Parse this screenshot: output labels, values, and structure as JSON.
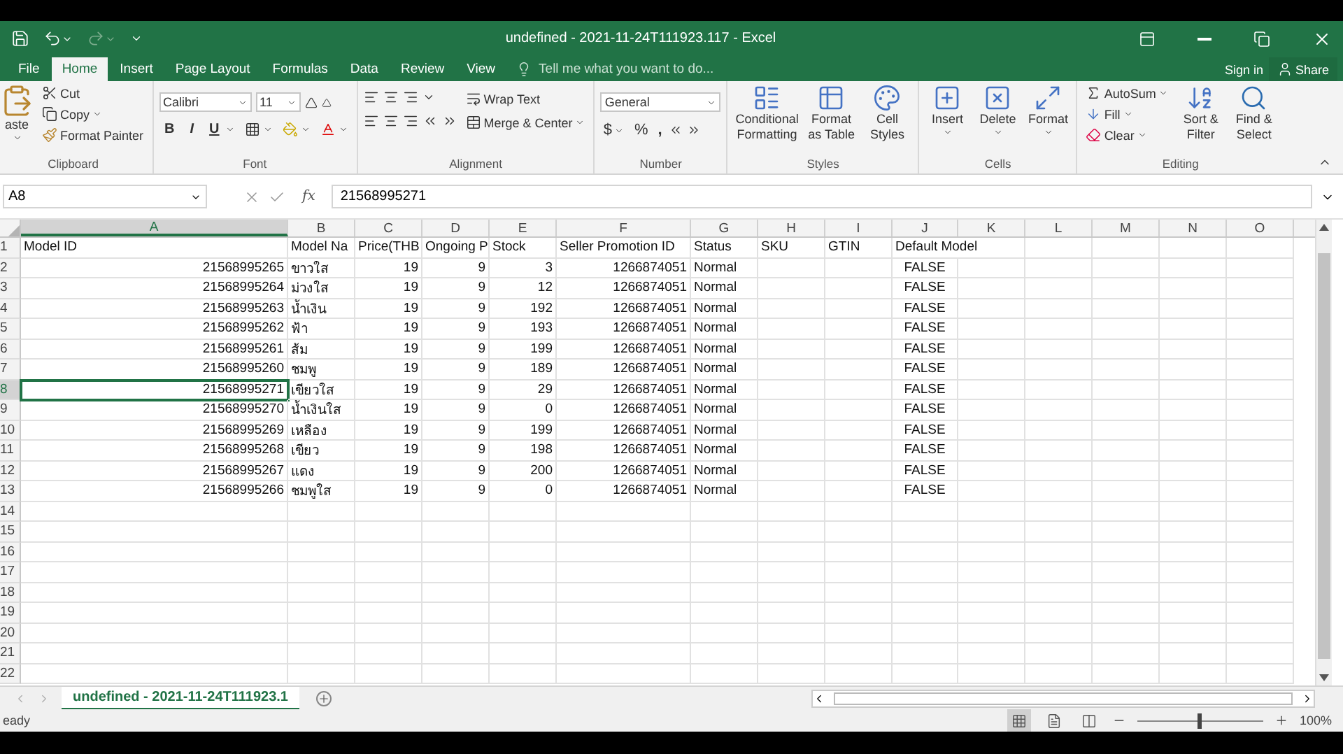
{
  "window": {
    "title": "undefined - 2021-11-24T111923.117 - Excel"
  },
  "menu_tabs": [
    {
      "label": "File",
      "selected": false
    },
    {
      "label": "Home",
      "selected": true
    },
    {
      "label": "Insert",
      "selected": false
    },
    {
      "label": "Page Layout",
      "selected": false
    },
    {
      "label": "Formulas",
      "selected": false
    },
    {
      "label": "Data",
      "selected": false
    },
    {
      "label": "Review",
      "selected": false
    },
    {
      "label": "View",
      "selected": false
    }
  ],
  "tell_me": {
    "placeholder": "Tell me what you want to do..."
  },
  "account": {
    "sign_in": "Sign in",
    "share": "Share"
  },
  "clipboard": {
    "paste": "aste",
    "cut": "Cut",
    "copy": "Copy",
    "format_painter": "Format Painter",
    "label": "Clipboard"
  },
  "font": {
    "name": "Calibri",
    "size": "11",
    "bold": "B",
    "italic": "I",
    "underline": "U",
    "label": "Font"
  },
  "alignment": {
    "wrap_text": "Wrap Text",
    "merge": "Merge & Center",
    "label": "Alignment"
  },
  "number": {
    "format": "General",
    "currency": "$",
    "percent": "%",
    "comma": ",",
    "label": "Number"
  },
  "styles": {
    "buttons": [
      "Conditional Formatting",
      "Format as Table",
      "Cell Styles"
    ],
    "label": "Styles"
  },
  "cells": {
    "buttons": [
      "Insert",
      "Delete",
      "Format"
    ],
    "label": "Cells"
  },
  "editing": {
    "autosum": "AutoSum",
    "fill": "Fill",
    "clear": "Clear",
    "sort": "Sort & Filter",
    "find": "Find & Select",
    "label": "Editing"
  },
  "formula_bar": {
    "name_box": "A8",
    "fx": "fx",
    "value": "21568995271"
  },
  "sheet": {
    "columns": [
      {
        "label": "A",
        "selected": true
      },
      {
        "label": "B",
        "selected": false
      },
      {
        "label": "C",
        "selected": false
      },
      {
        "label": "D",
        "selected": false
      },
      {
        "label": "E",
        "selected": false
      },
      {
        "label": "F",
        "selected": false
      },
      {
        "label": "G",
        "selected": false
      },
      {
        "label": "H",
        "selected": false
      },
      {
        "label": "I",
        "selected": false
      },
      {
        "label": "J",
        "selected": false
      },
      {
        "label": "K",
        "selected": false
      },
      {
        "label": "L",
        "selected": false
      },
      {
        "label": "M",
        "selected": false
      },
      {
        "label": "N",
        "selected": false
      },
      {
        "label": "O",
        "selected": false
      }
    ],
    "rows": [
      {
        "number": "1",
        "kind": "header",
        "selected": false,
        "cells": [
          "Model ID",
          "Model Na",
          "Price(THB",
          "Ongoing P",
          "Stock",
          "Seller Promotion ID",
          "Status",
          "SKU",
          "GTIN",
          "Default Model"
        ]
      },
      {
        "number": "2",
        "kind": "data",
        "selected": false,
        "cells": [
          "21568995265",
          "ขาวใส",
          "19",
          "9",
          "3",
          "1266874051",
          "Normal",
          null,
          null,
          "FALSE"
        ]
      },
      {
        "number": "3",
        "kind": "data",
        "selected": false,
        "cells": [
          "21568995264",
          "ม่วงใส",
          "19",
          "9",
          "12",
          "1266874051",
          "Normal",
          null,
          null,
          "FALSE"
        ]
      },
      {
        "number": "4",
        "kind": "data",
        "selected": false,
        "cells": [
          "21568995263",
          "น้ำเงิน",
          "19",
          "9",
          "192",
          "1266874051",
          "Normal",
          null,
          null,
          "FALSE"
        ]
      },
      {
        "number": "5",
        "kind": "data",
        "selected": false,
        "cells": [
          "21568995262",
          "ฟ้า",
          "19",
          "9",
          "193",
          "1266874051",
          "Normal",
          null,
          null,
          "FALSE"
        ]
      },
      {
        "number": "6",
        "kind": "data",
        "selected": false,
        "cells": [
          "21568995261",
          "ส้ม",
          "19",
          "9",
          "199",
          "1266874051",
          "Normal",
          null,
          null,
          "FALSE"
        ]
      },
      {
        "number": "7",
        "kind": "data",
        "selected": false,
        "cells": [
          "21568995260",
          "ชมพู",
          "19",
          "9",
          "189",
          "1266874051",
          "Normal",
          null,
          null,
          "FALSE"
        ]
      },
      {
        "number": "8",
        "kind": "data",
        "selected": true,
        "cells": [
          "21568995271",
          "เขียวใส",
          "19",
          "9",
          "29",
          "1266874051",
          "Normal",
          null,
          null,
          "FALSE"
        ]
      },
      {
        "number": "9",
        "kind": "data",
        "selected": false,
        "cells": [
          "21568995270",
          "น้ำเงินใส",
          "19",
          "9",
          "0",
          "1266874051",
          "Normal",
          null,
          null,
          "FALSE"
        ]
      },
      {
        "number": "10",
        "kind": "data",
        "selected": false,
        "cells": [
          "21568995269",
          "เหลือง",
          "19",
          "9",
          "199",
          "1266874051",
          "Normal",
          null,
          null,
          "FALSE"
        ]
      },
      {
        "number": "11",
        "kind": "data",
        "selected": false,
        "cells": [
          "21568995268",
          "เขียว",
          "19",
          "9",
          "198",
          "1266874051",
          "Normal",
          null,
          null,
          "FALSE"
        ]
      },
      {
        "number": "12",
        "kind": "data",
        "selected": false,
        "cells": [
          "21568995267",
          "แดง",
          "19",
          "9",
          "200",
          "1266874051",
          "Normal",
          null,
          null,
          "FALSE"
        ]
      },
      {
        "number": "13",
        "kind": "data",
        "selected": false,
        "cells": [
          "21568995266",
          "ชมพูใส",
          "19",
          "9",
          "0",
          "1266874051",
          "Normal",
          null,
          null,
          "FALSE"
        ]
      },
      {
        "number": "14",
        "kind": "data",
        "selected": false
      },
      {
        "number": "15",
        "kind": "data",
        "selected": false
      },
      {
        "number": "16",
        "kind": "data",
        "selected": false
      },
      {
        "number": "17",
        "kind": "data",
        "selected": false
      },
      {
        "number": "18",
        "kind": "data",
        "selected": false
      },
      {
        "number": "19",
        "kind": "data",
        "selected": false
      },
      {
        "number": "20",
        "kind": "data",
        "selected": false
      },
      {
        "number": "21",
        "kind": "data",
        "selected": false
      },
      {
        "number": "22",
        "kind": "data",
        "selected": false
      }
    ]
  },
  "sheet_tabs": [
    {
      "label": "undefined - 2021-11-24T111923.1",
      "selected": true
    }
  ],
  "status_bar": {
    "status": "eady",
    "views": [
      {
        "selected": true
      },
      {
        "selected": false
      },
      {
        "selected": false
      }
    ],
    "zoom": {
      "level": 0.5
    },
    "zoom_reading": "100%"
  }
}
